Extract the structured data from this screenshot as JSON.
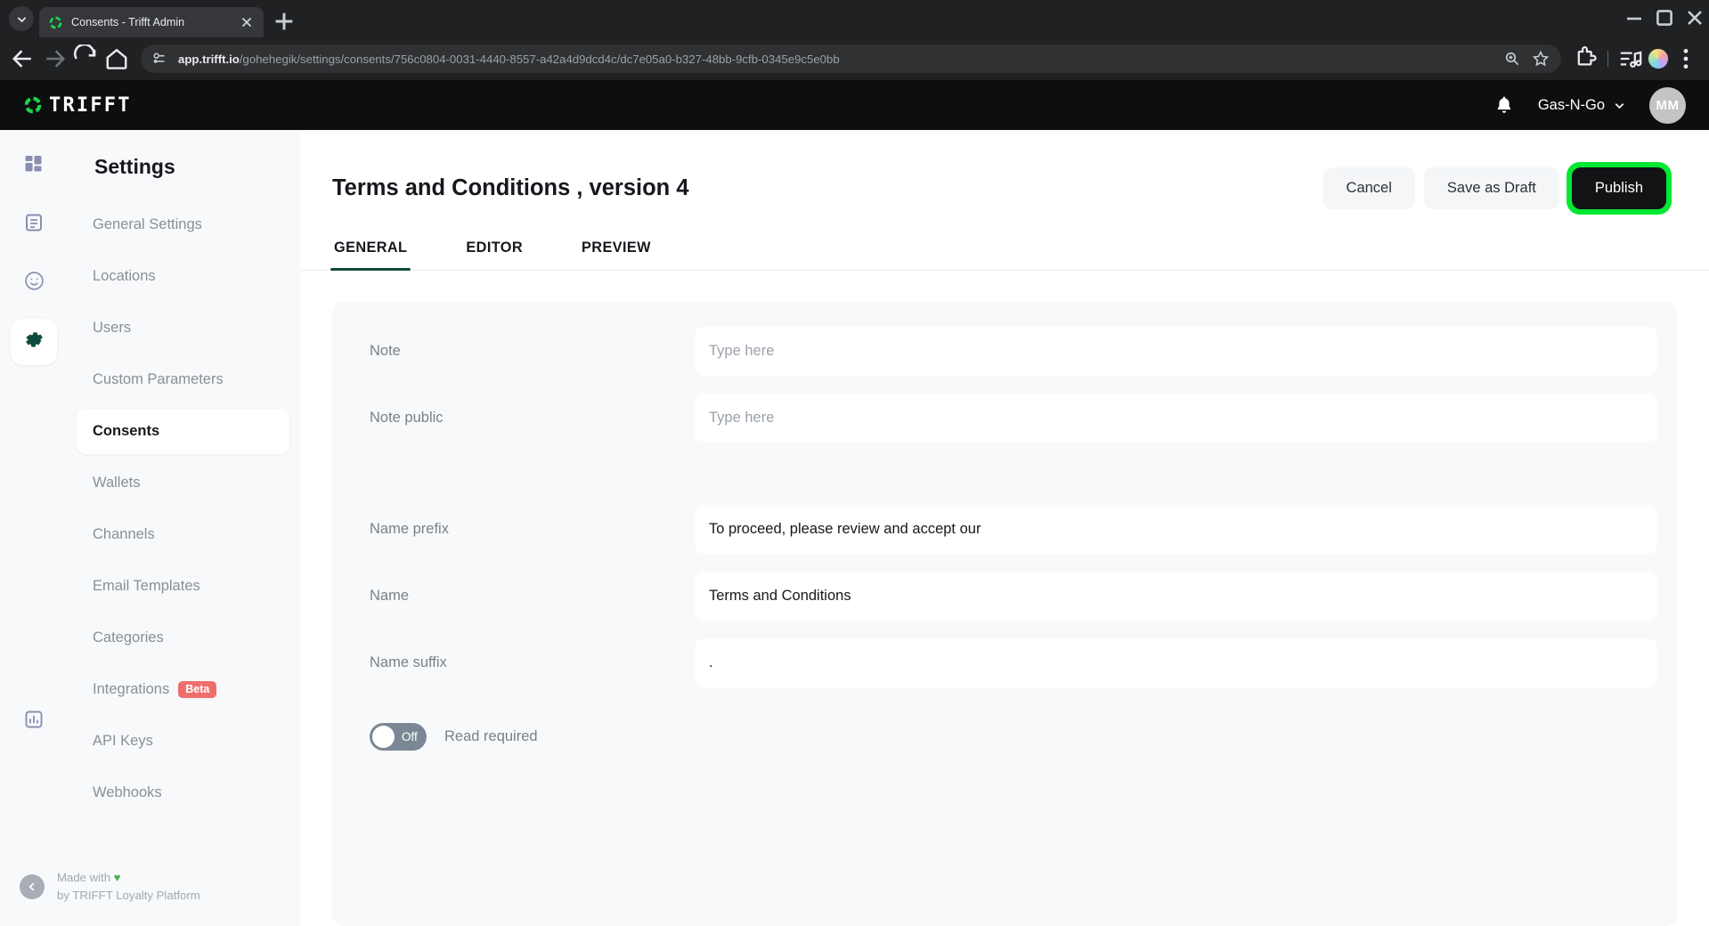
{
  "browser": {
    "tab": {
      "title": "Consents - Trifft Admin",
      "favicon": "trifft-ring-icon"
    },
    "new_tab_label": "+",
    "url_host": "app.trifft.io",
    "url_path": "/gohehegik/settings/consents/756c0804-0031-4440-8557-a42a4d9dcd4c/dc7e05a0-b327-48bb-9cfb-0345e9c5e0bb",
    "icons": {
      "back": "back-arrow-icon",
      "forward": "forward-arrow-icon",
      "reload": "reload-icon",
      "home": "home-icon",
      "site_info": "site-settings-icon",
      "zoom": "zoom-icon",
      "bookmark": "star-icon",
      "extensions": "extensions-puzzle-icon",
      "media": "media-controls-icon",
      "profile": "profile-avatar-icon",
      "menu": "kebab-menu-icon",
      "minimize": "minimize-icon",
      "maximize": "maximize-icon",
      "close": "window-close-icon"
    }
  },
  "appbar": {
    "logo_text": "TRIFFT",
    "bell_icon": "notification-bell-icon",
    "org_name": "Gas-N-Go",
    "org_chevron": "chevron-down-icon",
    "avatar_initials": "MM"
  },
  "sidebar": {
    "title": "Settings",
    "rail": [
      {
        "name": "dashboard",
        "icon": "dashboard-grid-icon",
        "active": false
      },
      {
        "name": "content",
        "icon": "document-lines-icon",
        "active": false
      },
      {
        "name": "engagement",
        "icon": "smiley-face-icon",
        "active": false
      },
      {
        "name": "settings",
        "icon": "gear-icon",
        "active": true
      },
      {
        "name": "reports",
        "icon": "bar-chart-icon",
        "active": false
      }
    ],
    "items": [
      {
        "label": "General Settings",
        "active": false
      },
      {
        "label": "Locations",
        "active": false
      },
      {
        "label": "Users",
        "active": false
      },
      {
        "label": "Custom Parameters",
        "active": false
      },
      {
        "label": "Consents",
        "active": true
      },
      {
        "label": "Wallets",
        "active": false
      },
      {
        "label": "Channels",
        "active": false
      },
      {
        "label": "Email Templates",
        "active": false
      },
      {
        "label": "Categories",
        "active": false
      },
      {
        "label": "Integrations",
        "active": false,
        "badge": "Beta"
      },
      {
        "label": "API Keys",
        "active": false
      },
      {
        "label": "Webhooks",
        "active": false
      }
    ],
    "footer": {
      "line1": "Made with",
      "heart": "♥",
      "line2": "by TRIFFT Loyalty Platform",
      "collapse_icon": "chevron-left-icon"
    }
  },
  "page": {
    "title": "Terms and Conditions , version 4",
    "actions": {
      "cancel": "Cancel",
      "save_draft": "Save as Draft",
      "publish": "Publish",
      "publish_highlight_color": "#00e832"
    },
    "tabs": [
      {
        "label": "GENERAL",
        "active": true
      },
      {
        "label": "EDITOR",
        "active": false
      },
      {
        "label": "PREVIEW",
        "active": false
      }
    ],
    "fields": [
      {
        "label": "Note",
        "value": "",
        "placeholder": "Type here"
      },
      {
        "label": "Note public",
        "value": "",
        "placeholder": "Type here"
      },
      {
        "label": "Name prefix",
        "value": "To proceed, please review and accept our",
        "placeholder": ""
      },
      {
        "label": "Name",
        "value": "Terms and Conditions",
        "placeholder": ""
      },
      {
        "label": "Name suffix",
        "value": ".",
        "placeholder": ""
      }
    ],
    "toggle": {
      "state": "Off",
      "label": "Read required",
      "on": false
    }
  },
  "colors": {
    "accent_green": "#0f4b3c",
    "brand_green": "#22c55e",
    "highlight_green": "#00e832",
    "beta_red": "#ee6e6b",
    "page_bg": "#f7f9fb"
  }
}
